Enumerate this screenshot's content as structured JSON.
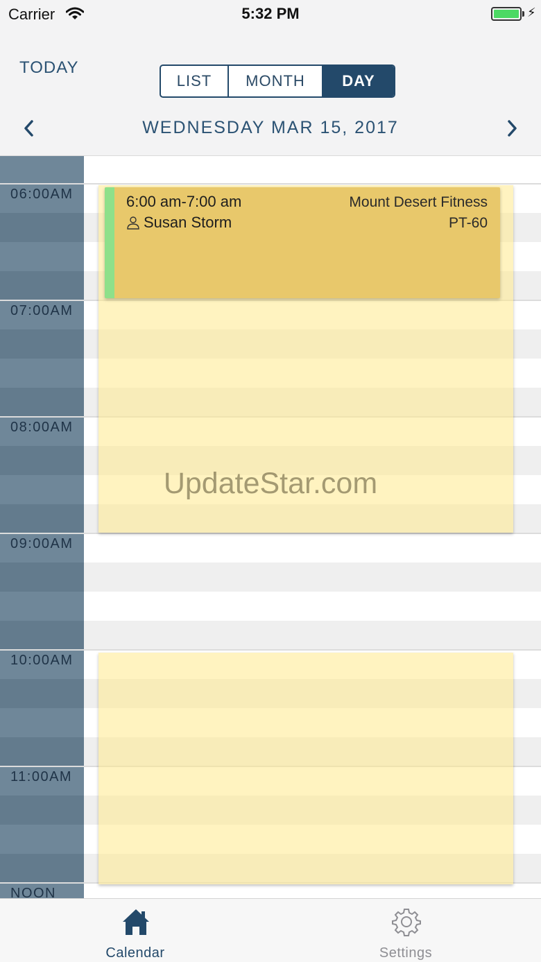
{
  "status_bar": {
    "carrier": "Carrier",
    "time": "5:32 PM",
    "battery_level_percent": 100,
    "icons": [
      "wifi-icon",
      "battery-icon",
      "charging-bolt-icon"
    ]
  },
  "header": {
    "today_label": "TODAY",
    "view_tabs": [
      {
        "label": "LIST",
        "selected": false
      },
      {
        "label": "MONTH",
        "selected": false
      },
      {
        "label": "DAY",
        "selected": true
      }
    ],
    "date_title": "WEDNESDAY MAR 15, 2017",
    "prev_icon": "chevron-left-icon",
    "next_icon": "chevron-right-icon"
  },
  "timeline": {
    "hours": [
      "06:00AM",
      "07:00AM",
      "08:00AM",
      "09:00AM",
      "10:00AM",
      "11:00AM",
      "NOON"
    ]
  },
  "event": {
    "time_range": "6:00 am-7:00 am",
    "person": "Susan Storm",
    "location": "Mount Desert Fitness",
    "service": "PT-60",
    "person_icon": "person-icon"
  },
  "watermark": "UpdateStar.com",
  "tabbar": {
    "items": [
      {
        "label": "Calendar",
        "icon": "home-icon",
        "selected": true
      },
      {
        "label": "Settings",
        "icon": "gear-icon",
        "selected": false
      }
    ]
  },
  "colors": {
    "primary": "#23496a",
    "time_column": "#6f8799",
    "availability_block": "#fff1b8",
    "event_fill": "#e6c464",
    "event_accent": "#8ee08a"
  }
}
